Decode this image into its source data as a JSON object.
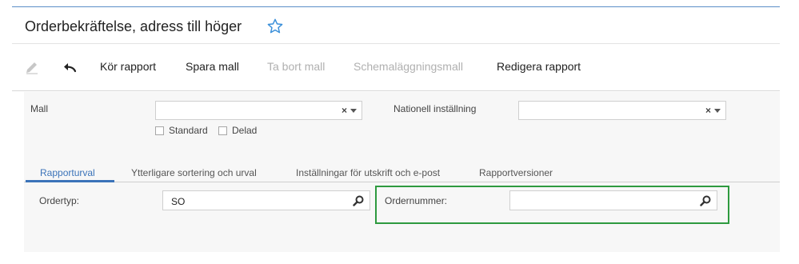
{
  "header": {
    "title": "Orderbekräftelse, adress till höger",
    "favorite_icon": "star-outline-icon",
    "favorite_color": "#3a8fd9"
  },
  "toolbar": {
    "edit_icon": "pencil-icon",
    "undo_icon": "undo-arrow-icon",
    "run_report": "Kör rapport",
    "save_template": "Spara mall",
    "delete_template": "Ta bort mall",
    "schedule_template": "Schemaläggningsmall",
    "edit_report": "Redigera rapport"
  },
  "form": {
    "template_label": "Mall",
    "template_value": "",
    "standard_label": "Standard",
    "shared_label": "Delad",
    "locale_label": "Nationell inställning",
    "locale_value": "",
    "clear_symbol": "×"
  },
  "tabs": [
    {
      "label": "Rapporturval",
      "active": true
    },
    {
      "label": "Ytterligare sortering och urval",
      "active": false
    },
    {
      "label": "Inställningar för utskrift och e-post",
      "active": false
    },
    {
      "label": "Rapportversioner",
      "active": false
    }
  ],
  "selection": {
    "order_type_label": "Ordertyp:",
    "order_type_value": "SO",
    "order_number_label": "Ordernummer:",
    "order_number_value": ""
  },
  "colors": {
    "accent": "#3b73b9",
    "highlight": "#2e9a3f",
    "disabled_text": "#b0b0b0"
  }
}
